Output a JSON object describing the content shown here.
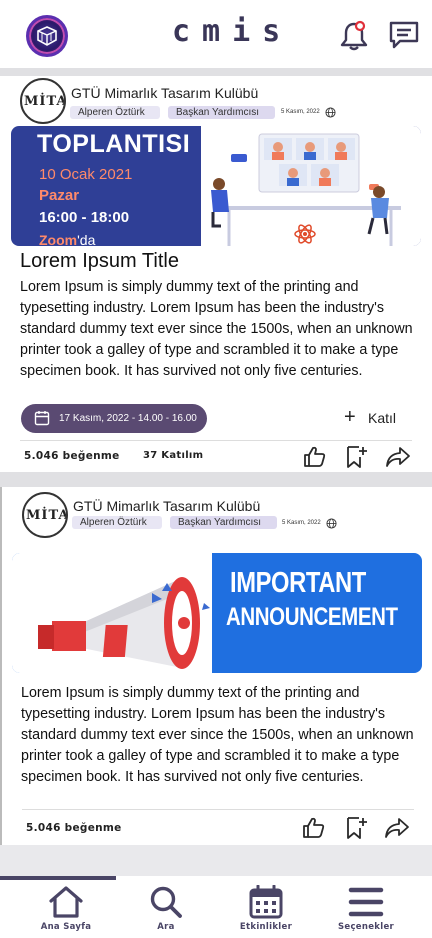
{
  "app": {
    "title": "cmis"
  },
  "header": {
    "logo_icon": "club-logo-icon",
    "notification_icon": "bell-icon",
    "messages_icon": "chat-icon"
  },
  "posts": [
    {
      "club_name": "GTÜ Mimarlık Tasarım Kulübü",
      "avatar_text": "MİTA",
      "author": "Alperen Öztürk",
      "role": "Başkan Yardımcısı",
      "date": "5 Kasım, 2022",
      "banner": {
        "title": "TOPLANTISI",
        "date": "10 Ocak 2021",
        "day": "Pazar",
        "time": "16:00 - 18:00",
        "platform": "Zoom",
        "platform_suffix": "'da"
      },
      "title": "Lorem Ipsum Title",
      "body": "Lorem Ipsum is simply dummy text of the printing and typesetting industry. Lorem Ipsum has been the industry's standard dummy text ever since the 1500s, when an unknown printer took a galley of type and scrambled it to make a type specimen book. It has survived not only five centuries.",
      "event_time": "17 Kasım, 2022 - 14.00 - 16.00",
      "join_label": "Katıl",
      "likes": "5.046 beğenme",
      "attendees": "37 Katılım"
    },
    {
      "club_name": "GTÜ Mimarlık Tasarım Kulübü",
      "avatar_text": "MİTA",
      "author": "Alperen Öztürk",
      "role": "Başkan Yardımcısı",
      "date": "5 Kasım, 2022",
      "banner": {
        "line1": "IMPORTANT",
        "line2": "ANNOUNCEMENT"
      },
      "body": "Lorem Ipsum is simply dummy text of the printing and typesetting industry. Lorem Ipsum has been the industry's standard dummy text ever since the 1500s, when an unknown printer took a galley of type and scrambled it to make a type specimen book. It has survived not only five centuries.",
      "likes": "5.046 beğenme"
    }
  ],
  "bottom_nav": [
    {
      "label": "Ana Sayfa",
      "icon": "home-icon"
    },
    {
      "label": "Ara",
      "icon": "search-icon"
    },
    {
      "label": "Etkinlikler",
      "icon": "calendar-icon"
    },
    {
      "label": "Seçenekler",
      "icon": "menu-icon"
    }
  ],
  "colors": {
    "accent": "#4a4566",
    "pill": "#5a4a72",
    "chip": "#e8e6f4"
  }
}
